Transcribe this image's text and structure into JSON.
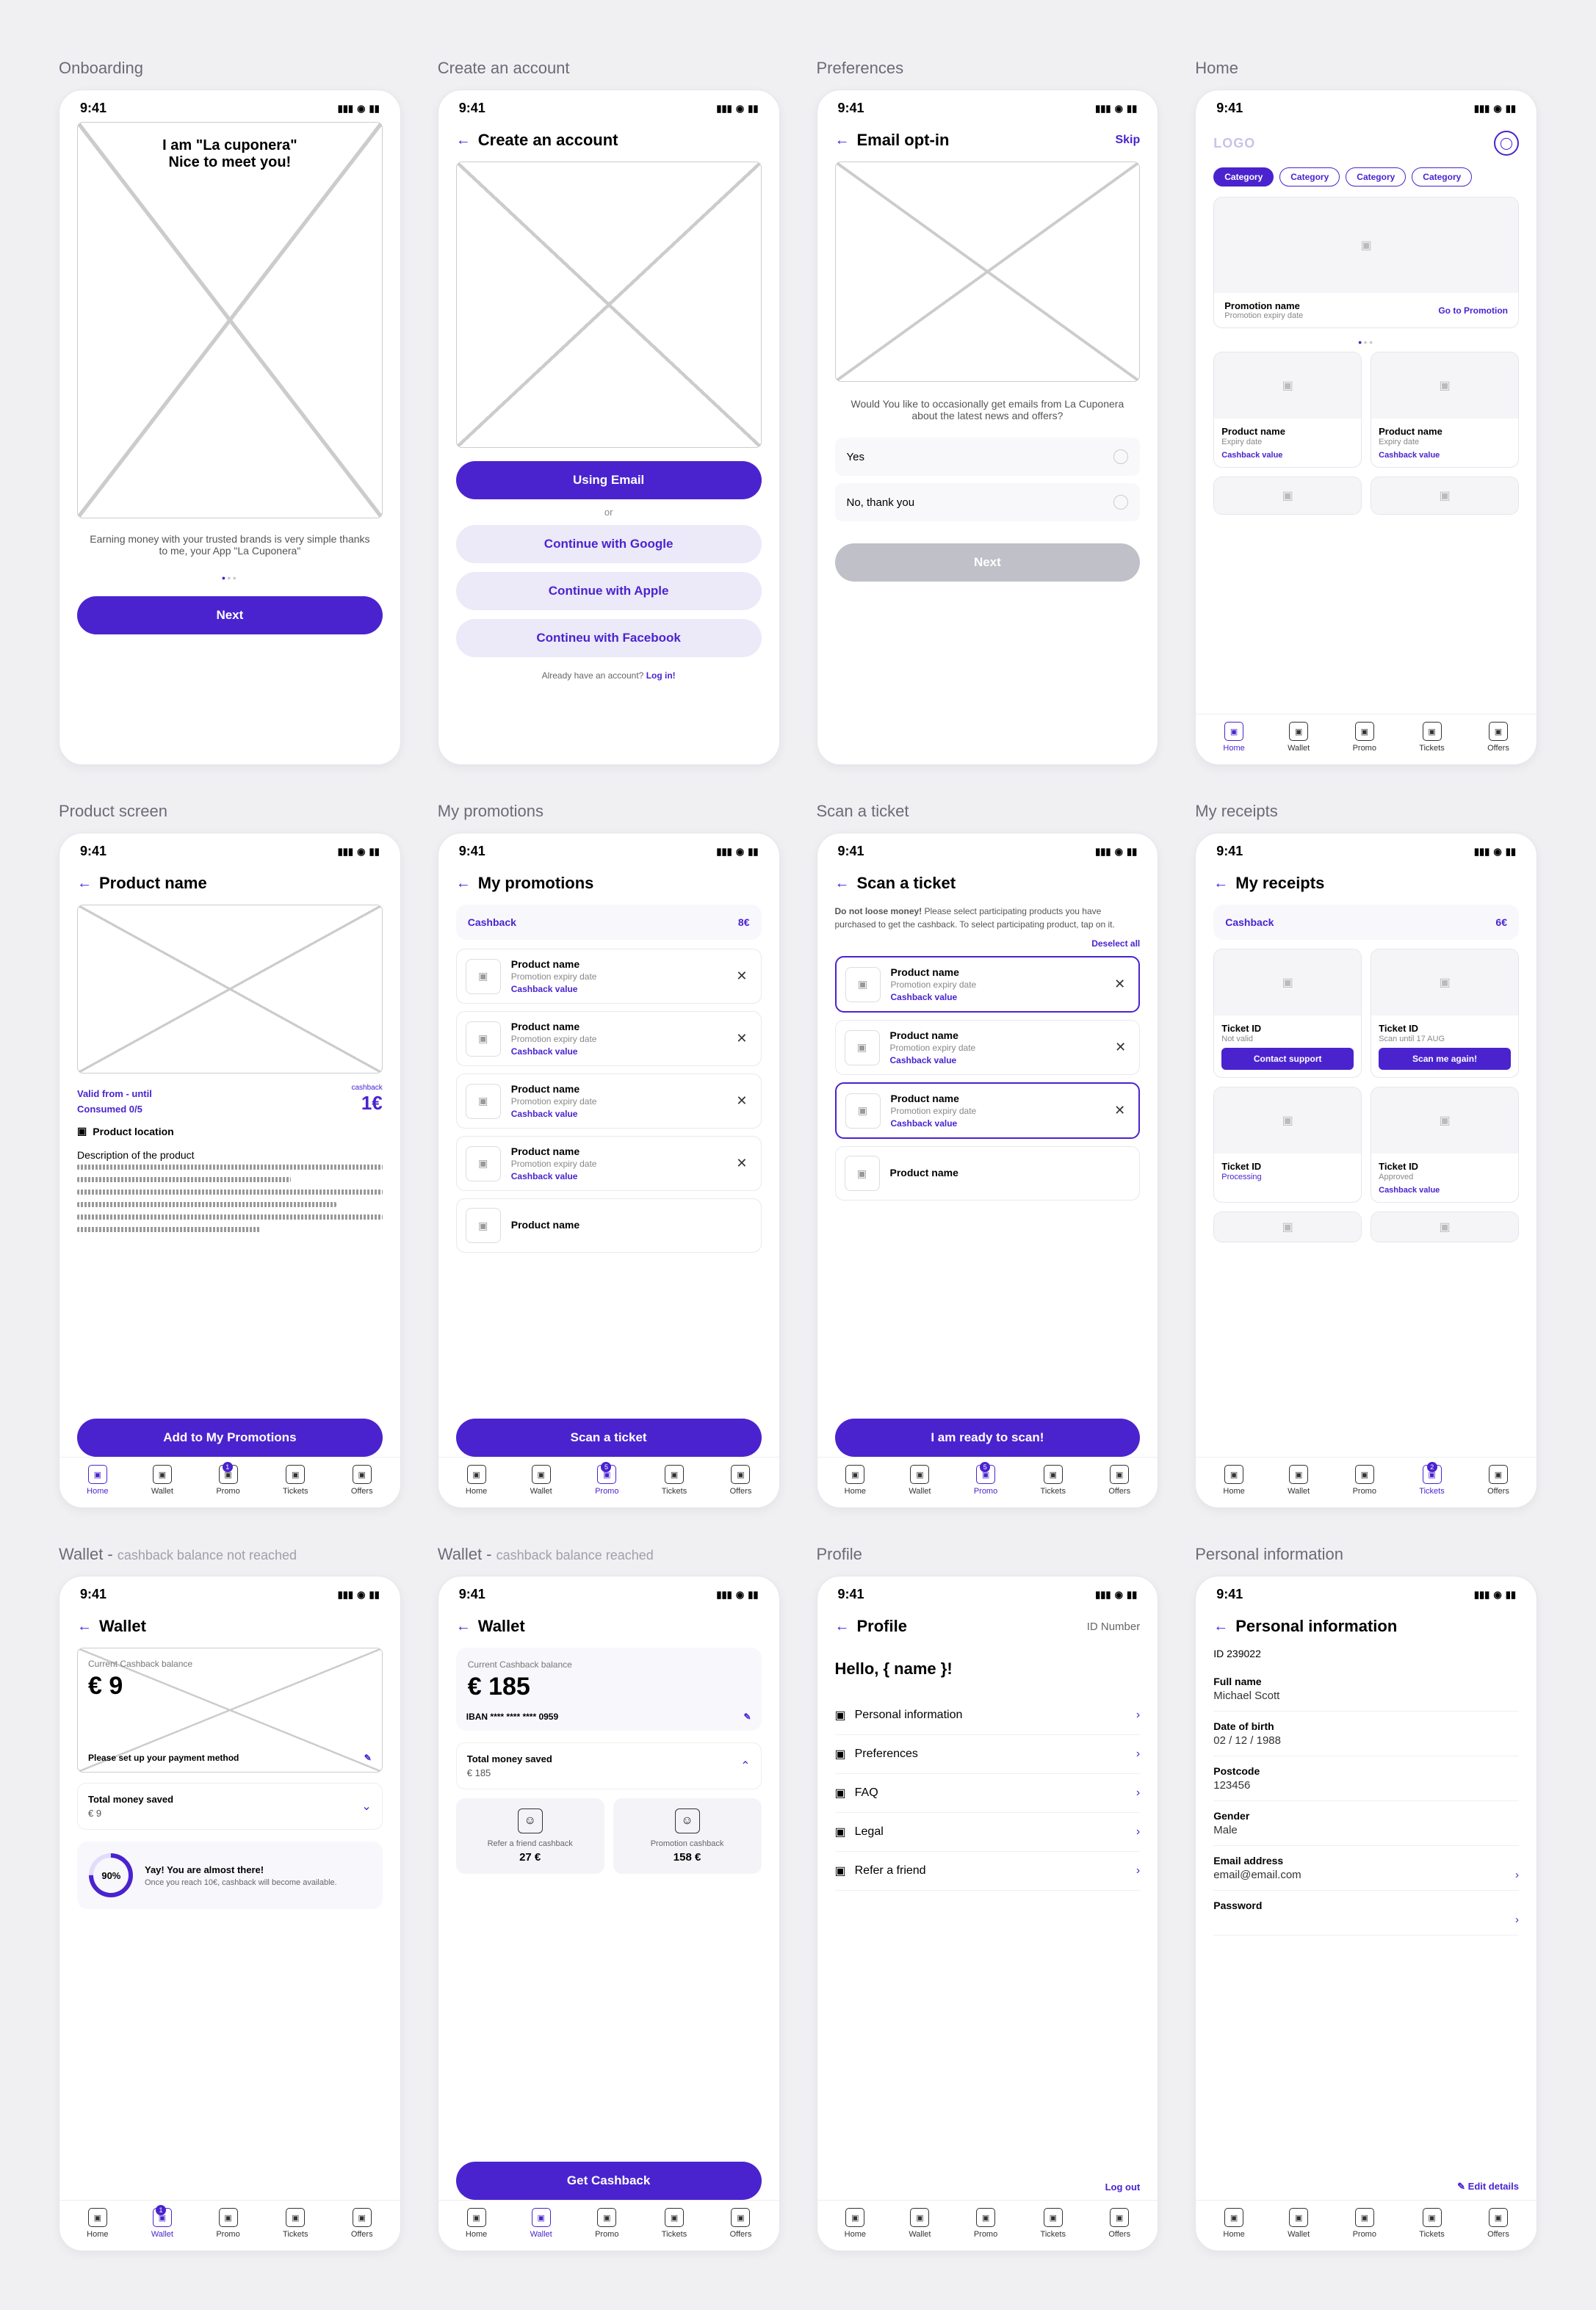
{
  "statusbar": {
    "time": "9:41"
  },
  "tabs": {
    "home": "Home",
    "wallet": "Wallet",
    "promo": "Promo",
    "tickets": "Tickets",
    "offers": "Offers"
  },
  "screens": {
    "onboarding": {
      "title": "Onboarding",
      "headline": "I am \"La cuponera\"\nNice to meet you!",
      "desc": "Earning money with your trusted brands is very simple thanks to me, your App \"La Cuponera\"",
      "cta": "Next"
    },
    "create": {
      "title": "Create an account",
      "header": "Create an account",
      "email": "Using Email",
      "or": "or",
      "google": "Continue with Google",
      "apple": "Continue with Apple",
      "facebook": "Contineu with Facebook",
      "already": "Already have an account? ",
      "login": "Log in!"
    },
    "prefs": {
      "title": "Preferences",
      "header": "Email opt-in",
      "skip": "Skip",
      "body": "Would You like to occasionally get emails from La Cuponera about the latest news and offers?",
      "yes": "Yes",
      "no": "No, thank you",
      "cta": "Next"
    },
    "home": {
      "title": "Home",
      "logo": "LOGO",
      "cat": "Category",
      "promo_name": "Promotion name",
      "promo_date": "Promotion expiry date",
      "goto": "Go to Promotion",
      "prod_name": "Product name",
      "expiry": "Expiry date",
      "cb": "Cashback value"
    },
    "product": {
      "title": "Product screen",
      "header": "Product name",
      "validity": "Valid from - until",
      "consumed": "Consumed 0/5",
      "cb_label": "cashback",
      "cb_val": "1€",
      "location": "Product location",
      "desc": "Description of the product",
      "cta": "Add to My Promotions"
    },
    "mypromo": {
      "title": "My promotions",
      "header": "My promotions",
      "cashback": "Cashback",
      "cb_val": "8€",
      "prod": "Product name",
      "date": "Promotion expiry date",
      "cb": "Cashback value",
      "cta": "Scan a ticket"
    },
    "scan": {
      "title": "Scan a ticket",
      "header": "Scan a ticket",
      "warn_bold": "Do not loose money!",
      "warn": " Please select participating products you have purchased to get the cashback. To select participating product, tap on it.",
      "deselect": "Deselect all",
      "prod": "Product name",
      "date": "Promotion expiry date",
      "cb": "Cashback value",
      "cta": "I am ready to scan!"
    },
    "receipts": {
      "title": "My receipts",
      "header": "My receipts",
      "cashback": "Cashback",
      "cb_val": "6€",
      "tid": "Ticket ID",
      "notvalid": "Not valid",
      "contact": "Contact support",
      "scanuntil": "Scan until 17 AUG",
      "scanagain": "Scan me again!",
      "processing": "Processing",
      "approved": "Approved",
      "cbv": "Cashback value"
    },
    "wallet1": {
      "title": "Wallet - ",
      "sub": "cashback balance not reached",
      "header": "Wallet",
      "bal_label": "Current Cashback balance",
      "bal": "€ 9",
      "setup": "Please set up your payment method",
      "total_lbl": "Total money saved",
      "total": "€ 9",
      "ring": "90%",
      "yay": "Yay! You are almost there!",
      "yay_desc": "Once you reach 10€, cashback will become available."
    },
    "wallet2": {
      "title": "Wallet - ",
      "sub": "cashback balance reached",
      "header": "Wallet",
      "bal_label": "Current Cashback balance",
      "bal": "€ 185",
      "iban": "IBAN **** **** **** 0959",
      "total_lbl": "Total money saved",
      "total": "€ 185",
      "refer_lbl": "Refer a friend cashback",
      "refer_val": "27 €",
      "promo_lbl": "Promotion cashback",
      "promo_val": "158 €",
      "cta": "Get Cashback"
    },
    "profile": {
      "title": "Profile",
      "header": "Profile",
      "idnum": "ID Number",
      "hello": "Hello, { name }!",
      "personal": "Personal information",
      "prefs": "Preferences",
      "faq": "FAQ",
      "legal": "Legal",
      "refer": "Refer a friend",
      "logout": "Log out"
    },
    "personal": {
      "title": "Personal information",
      "header": "Personal information",
      "id": "ID 239022",
      "name_lbl": "Full name",
      "name": "Michael Scott",
      "dob_lbl": "Date of birth",
      "dob": "02 / 12 / 1988",
      "post_lbl": "Postcode",
      "post": "123456",
      "gender_lbl": "Gender",
      "gender": "Male",
      "email_lbl": "Email address",
      "email": "email@email.com",
      "pwd_lbl": "Password",
      "edit": "✎ Edit details"
    }
  }
}
